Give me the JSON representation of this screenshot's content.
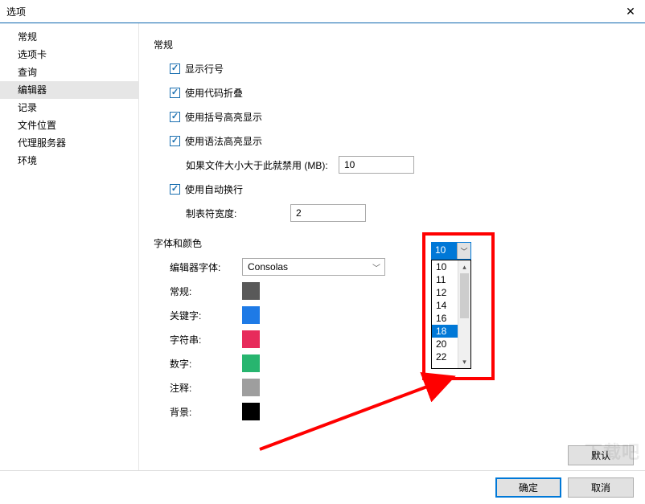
{
  "window": {
    "title": "选项"
  },
  "sidebar": {
    "items": [
      {
        "label": "常规"
      },
      {
        "label": "选项卡"
      },
      {
        "label": "查询"
      },
      {
        "label": "编辑器"
      },
      {
        "label": "记录"
      },
      {
        "label": "文件位置"
      },
      {
        "label": "代理服务器"
      },
      {
        "label": "环境"
      }
    ],
    "selected_index": 3
  },
  "general": {
    "title": "常规",
    "show_line_numbers": {
      "label": "显示行号",
      "checked": true
    },
    "code_folding": {
      "label": "使用代码折叠",
      "checked": true
    },
    "bracket_hl": {
      "label": "使用括号高亮显示",
      "checked": true
    },
    "syntax_hl": {
      "label": "使用语法高亮显示",
      "checked": true
    },
    "syntax_disable": {
      "label": "如果文件大小大于此就禁用 (MB):",
      "value": "10"
    },
    "auto_wrap": {
      "label": "使用自动换行",
      "checked": true
    },
    "tab_width": {
      "label": "制表符宽度:",
      "value": "2"
    }
  },
  "fonts": {
    "title": "字体和颜色",
    "editor_font_label": "编辑器字体:",
    "editor_font_value": "Consolas",
    "font_size_value": "10",
    "font_size_options": [
      "10",
      "11",
      "12",
      "14",
      "16",
      "18",
      "20",
      "22"
    ],
    "font_size_highlighted": "18",
    "rows": [
      {
        "label": "常规:",
        "color": "#595959"
      },
      {
        "label": "关键字:",
        "color": "#1e7ae6"
      },
      {
        "label": "字符串:",
        "color": "#e72b5b"
      },
      {
        "label": "数字:",
        "color": "#27b56f"
      },
      {
        "label": "注释:",
        "color": "#9e9e9e"
      },
      {
        "label": "背景:",
        "color": "#000000"
      }
    ]
  },
  "buttons": {
    "default": "默认",
    "ok": "确定",
    "cancel": "取消"
  },
  "watermark": "下载吧"
}
